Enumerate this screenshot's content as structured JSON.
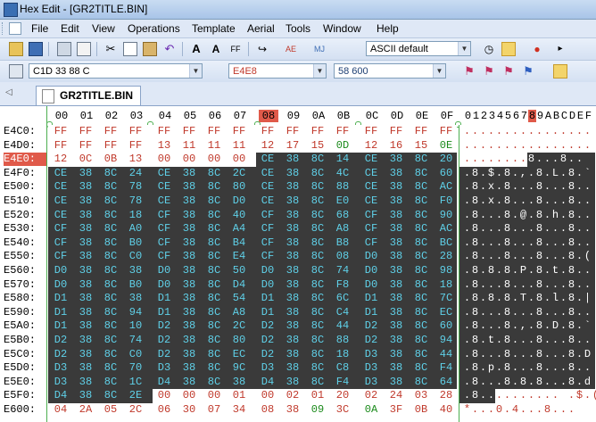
{
  "window": {
    "title": "Hex Edit - [GR2TITLE.BIN]"
  },
  "menu": [
    "File",
    "Edit",
    "View",
    "Operations",
    "Template",
    "Aerial",
    "Tools",
    "Window",
    "Help"
  ],
  "toolbar1": {
    "charset_combo": "ASCII default",
    "icons": [
      "open-icon",
      "save-icon",
      "print-icon",
      "print-preview-icon",
      "cut-icon",
      "copy-icon",
      "paste-icon",
      "undo-icon",
      "font-increase-icon",
      "font-decrease-icon",
      "autofit-icon",
      "ebcdic-icon",
      "search-replace-icon",
      "jump-icon"
    ]
  },
  "toolbar2": {
    "address_combo": "C1D 33 88 C",
    "hex_address": "E4E8",
    "dec_address": "58 600"
  },
  "tab": {
    "label": "GR2TITLE.BIN"
  },
  "header": {
    "hex_cols": [
      "00",
      "01",
      "02",
      "03",
      "04",
      "05",
      "06",
      "07",
      "08",
      "09",
      "0A",
      "0B",
      "0C",
      "0D",
      "0E",
      "0F"
    ],
    "ascii_cols": "0123456789ABCDEF",
    "selected_col": "08"
  },
  "rows": [
    {
      "off": "E4C0:",
      "hex": [
        "FF",
        "FF",
        "FF",
        "FF",
        "FF",
        "FF",
        "FF",
        "FF",
        "FF",
        "FF",
        "FF",
        "FF",
        "FF",
        "FF",
        "FF",
        "FF"
      ],
      "ascii": "................"
    },
    {
      "off": "E4D0:",
      "hex": [
        "FF",
        "FF",
        "FF",
        "FF",
        "13",
        "11",
        "11",
        "11",
        "12",
        "17",
        "15",
        "0D",
        "12",
        "16",
        "15",
        "0E"
      ],
      "ascii": "................"
    },
    {
      "off": "E4E0:",
      "hex": [
        "12",
        "0C",
        "0B",
        "13",
        "00",
        "00",
        "00",
        "00",
        "CE",
        "38",
        "8C",
        "14",
        "CE",
        "38",
        "8C",
        "20"
      ],
      "ascii": "........8...8.. "
    },
    {
      "off": "E4F0:",
      "hex": [
        "CE",
        "38",
        "8C",
        "24",
        "CE",
        "38",
        "8C",
        "2C",
        "CE",
        "38",
        "8C",
        "4C",
        "CE",
        "38",
        "8C",
        "60"
      ],
      "ascii": ".8.$.8.,.8.L.8.`"
    },
    {
      "off": "E500:",
      "hex": [
        "CE",
        "38",
        "8C",
        "78",
        "CE",
        "38",
        "8C",
        "80",
        "CE",
        "38",
        "8C",
        "88",
        "CE",
        "38",
        "8C",
        "AC"
      ],
      "ascii": ".8.x.8...8...8.."
    },
    {
      "off": "E510:",
      "hex": [
        "CE",
        "38",
        "8C",
        "78",
        "CE",
        "38",
        "8C",
        "D0",
        "CE",
        "38",
        "8C",
        "E0",
        "CE",
        "38",
        "8C",
        "F0"
      ],
      "ascii": ".8.x.8...8...8.."
    },
    {
      "off": "E520:",
      "hex": [
        "CE",
        "38",
        "8C",
        "18",
        "CF",
        "38",
        "8C",
        "40",
        "CF",
        "38",
        "8C",
        "68",
        "CF",
        "38",
        "8C",
        "90"
      ],
      "ascii": ".8...8.@.8.h.8.."
    },
    {
      "off": "E530:",
      "hex": [
        "CF",
        "38",
        "8C",
        "A0",
        "CF",
        "38",
        "8C",
        "A4",
        "CF",
        "38",
        "8C",
        "A8",
        "CF",
        "38",
        "8C",
        "AC"
      ],
      "ascii": ".8...8...8...8.."
    },
    {
      "off": "E540:",
      "hex": [
        "CF",
        "38",
        "8C",
        "B0",
        "CF",
        "38",
        "8C",
        "B4",
        "CF",
        "38",
        "8C",
        "B8",
        "CF",
        "38",
        "8C",
        "BC"
      ],
      "ascii": ".8...8...8...8.."
    },
    {
      "off": "E550:",
      "hex": [
        "CF",
        "38",
        "8C",
        "C0",
        "CF",
        "38",
        "8C",
        "E4",
        "CF",
        "38",
        "8C",
        "08",
        "D0",
        "38",
        "8C",
        "28"
      ],
      "ascii": ".8...8...8...8.("
    },
    {
      "off": "E560:",
      "hex": [
        "D0",
        "38",
        "8C",
        "38",
        "D0",
        "38",
        "8C",
        "50",
        "D0",
        "38",
        "8C",
        "74",
        "D0",
        "38",
        "8C",
        "98"
      ],
      "ascii": ".8.8.8.P.8.t.8.."
    },
    {
      "off": "E570:",
      "hex": [
        "D0",
        "38",
        "8C",
        "B0",
        "D0",
        "38",
        "8C",
        "D4",
        "D0",
        "38",
        "8C",
        "F8",
        "D0",
        "38",
        "8C",
        "18"
      ],
      "ascii": ".8...8...8...8.."
    },
    {
      "off": "E580:",
      "hex": [
        "D1",
        "38",
        "8C",
        "38",
        "D1",
        "38",
        "8C",
        "54",
        "D1",
        "38",
        "8C",
        "6C",
        "D1",
        "38",
        "8C",
        "7C"
      ],
      "ascii": ".8.8.8.T.8.l.8.|"
    },
    {
      "off": "E590:",
      "hex": [
        "D1",
        "38",
        "8C",
        "94",
        "D1",
        "38",
        "8C",
        "A8",
        "D1",
        "38",
        "8C",
        "C4",
        "D1",
        "38",
        "8C",
        "EC"
      ],
      "ascii": ".8...8...8...8.."
    },
    {
      "off": "E5A0:",
      "hex": [
        "D1",
        "38",
        "8C",
        "10",
        "D2",
        "38",
        "8C",
        "2C",
        "D2",
        "38",
        "8C",
        "44",
        "D2",
        "38",
        "8C",
        "60"
      ],
      "ascii": ".8...8.,.8.D.8.`"
    },
    {
      "off": "E5B0:",
      "hex": [
        "D2",
        "38",
        "8C",
        "74",
        "D2",
        "38",
        "8C",
        "80",
        "D2",
        "38",
        "8C",
        "88",
        "D2",
        "38",
        "8C",
        "94"
      ],
      "ascii": ".8.t.8...8...8.."
    },
    {
      "off": "E5C0:",
      "hex": [
        "D2",
        "38",
        "8C",
        "C0",
        "D2",
        "38",
        "8C",
        "EC",
        "D2",
        "38",
        "8C",
        "18",
        "D3",
        "38",
        "8C",
        "44"
      ],
      "ascii": ".8...8...8...8.D"
    },
    {
      "off": "E5D0:",
      "hex": [
        "D3",
        "38",
        "8C",
        "70",
        "D3",
        "38",
        "8C",
        "9C",
        "D3",
        "38",
        "8C",
        "C8",
        "D3",
        "38",
        "8C",
        "F4"
      ],
      "ascii": ".8.p.8...8...8.."
    },
    {
      "off": "E5E0:",
      "hex": [
        "D3",
        "38",
        "8C",
        "1C",
        "D4",
        "38",
        "8C",
        "38",
        "D4",
        "38",
        "8C",
        "F4",
        "D3",
        "38",
        "8C",
        "64"
      ],
      "ascii": ".8...8.8.8...8.d"
    },
    {
      "off": "E5F0:",
      "hex": [
        "D4",
        "38",
        "8C",
        "2E",
        "00",
        "00",
        "00",
        "01",
        "00",
        "02",
        "01",
        "20",
        "02",
        "24",
        "03",
        "28"
      ],
      "ascii": ".8.......... .$.("
    },
    {
      "off": "E600:",
      "hex": [
        "04",
        "2A",
        "05",
        "2C",
        "06",
        "30",
        "07",
        "34",
        "08",
        "38",
        "09",
        "3C",
        "0A",
        "3F",
        "0B",
        "40"
      ],
      "ascii": "*...0.4...8..."
    }
  ],
  "colors": {
    "red_text": "#c0392b",
    "green_text": "#1a8a1a",
    "cyan_text": "#5fd0e8",
    "dark_bg": "#3a3a3a",
    "highlight": "#e05a4a"
  }
}
